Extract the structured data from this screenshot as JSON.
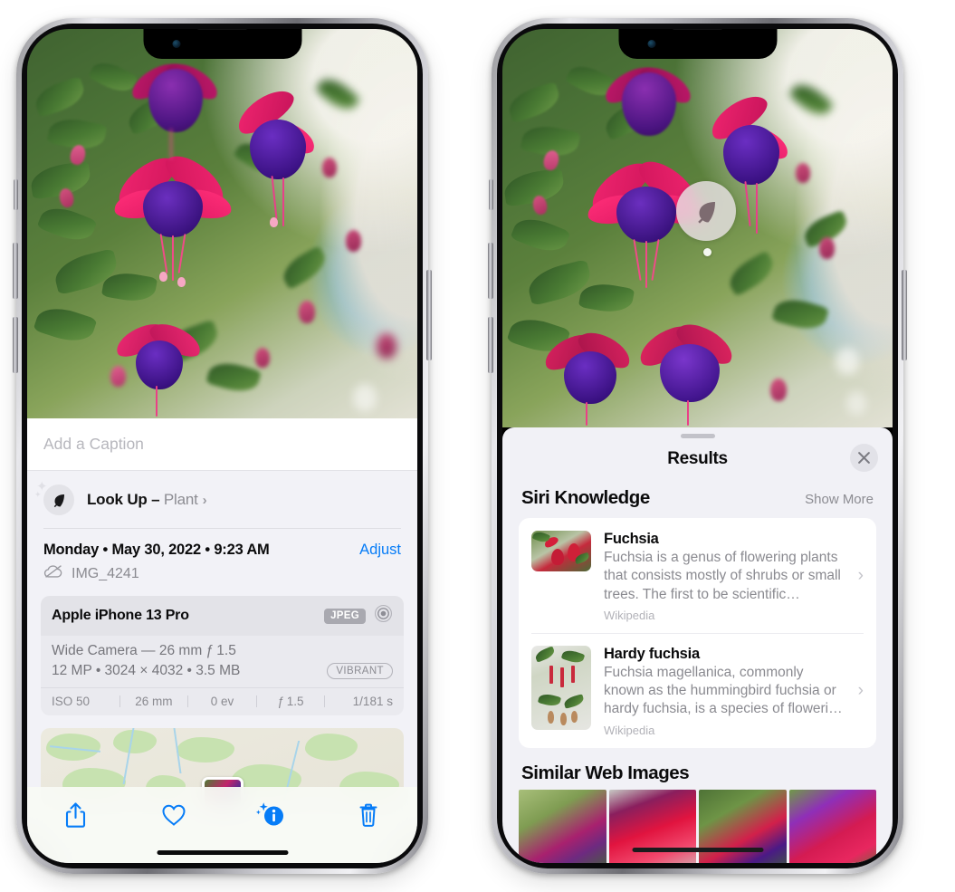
{
  "left_phone": {
    "caption": {
      "placeholder": "Add a Caption",
      "value": ""
    },
    "lookup": {
      "action": "Look Up – ",
      "subject": "Plant",
      "chevron": "›",
      "icon": "leaf-icon"
    },
    "meta": {
      "date": "Monday • May 30, 2022 • 9:23 AM",
      "adjust": "Adjust",
      "filename": "IMG_4241",
      "cloud_icon": "icloud-slash-icon"
    },
    "exif": {
      "device": "Apple iPhone 13 Pro",
      "format": "JPEG",
      "lens_icon": "aperture-icon",
      "lens": "Wide Camera — 26 mm ƒ 1.5",
      "size": "12 MP • 3024 × 4032 • 3.5 MB",
      "style": "VIBRANT",
      "stats": [
        "ISO 50",
        "26 mm",
        "0 ev",
        "ƒ 1.5",
        "1/181 s"
      ]
    },
    "toolbar": [
      {
        "name": "share-button",
        "icon": "share-icon"
      },
      {
        "name": "favorite-button",
        "icon": "heart-icon"
      },
      {
        "name": "info-button",
        "icon": "info-sparkle-icon"
      },
      {
        "name": "delete-button",
        "icon": "trash-icon"
      }
    ],
    "accent": "#067cf7"
  },
  "right_phone": {
    "badge": {
      "icon": "leaf-icon"
    },
    "sheet": {
      "title": "Results",
      "close": "✕"
    },
    "siri": {
      "title": "Siri Knowledge",
      "show_more": "Show More",
      "results": [
        {
          "name": "Fuchsia",
          "description": "Fuchsia is a genus of flowering plants that consists mostly of shrubs or small trees. The first to be scientific…",
          "source": "Wikipedia",
          "chevron": "›"
        },
        {
          "name": "Hardy fuchsia",
          "description": "Fuchsia magellanica, commonly known as the hummingbird fuchsia or hardy fuchsia, is a species of floweri…",
          "source": "Wikipedia",
          "chevron": "›"
        }
      ]
    },
    "web": {
      "title": "Similar Web Images",
      "count": 4
    }
  }
}
